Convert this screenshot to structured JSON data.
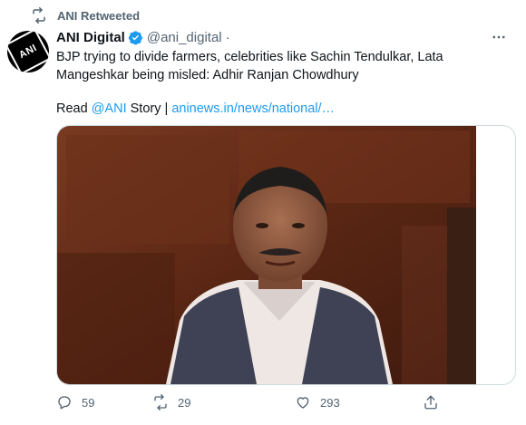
{
  "retweet_banner": {
    "label": "ANI Retweeted"
  },
  "author": {
    "display_name": "ANI Digital",
    "handle": "@ani_digital",
    "separator": "·",
    "avatar_text": "ANI",
    "verified": true
  },
  "tweet": {
    "text": "BJP trying to divide farmers, celebrities like Sachin Tendulkar, Lata Mangeshkar being misled: Adhir Ranjan Chowdhury",
    "read_prefix": "Read ",
    "mention": "@ANI",
    "read_middle": " Story | ",
    "url": "aninews.in/news/national/…"
  },
  "actions": {
    "reply_count": "59",
    "retweet_count": "29",
    "like_count": "293"
  },
  "icons": {
    "retweet_banner": "retweet-icon",
    "verified": "verified-badge-icon",
    "more": "more-icon",
    "reply": "reply-icon",
    "retweet": "retweet-icon",
    "like": "heart-icon",
    "share": "share-icon"
  },
  "colors": {
    "link": "#1d9bf0",
    "muted": "#536471",
    "text": "#0f1419"
  }
}
